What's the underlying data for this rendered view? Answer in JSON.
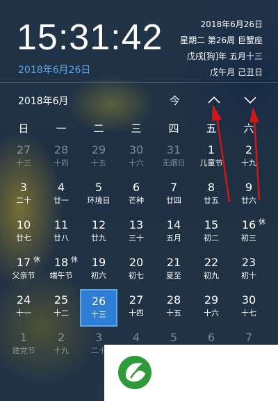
{
  "header": {
    "time": "15:31:42",
    "date_blue": "2018年6月26日",
    "right_lines": [
      "2018年6月26日",
      "星期二 第26周 巨蟹座",
      "戊戌[狗]年 五月十三",
      "戊午月 己丑日"
    ]
  },
  "nav": {
    "month": "2018年6月",
    "today": "今",
    "up_icon": "chevron-up-icon",
    "down_icon": "chevron-down-icon"
  },
  "weekdays": [
    "日",
    "一",
    "二",
    "三",
    "四",
    "五",
    "六"
  ],
  "days": [
    {
      "num": "27",
      "lunar": "十三",
      "other": true
    },
    {
      "num": "28",
      "lunar": "十四",
      "other": true
    },
    {
      "num": "29",
      "lunar": "十五",
      "other": true
    },
    {
      "num": "30",
      "lunar": "十六",
      "other": true
    },
    {
      "num": "31",
      "lunar": "无烟日",
      "other": true
    },
    {
      "num": "1",
      "lunar": "儿童节"
    },
    {
      "num": "2",
      "lunar": "十九"
    },
    {
      "num": "3",
      "lunar": "二十"
    },
    {
      "num": "4",
      "lunar": "廿一"
    },
    {
      "num": "5",
      "lunar": "环境日"
    },
    {
      "num": "6",
      "lunar": "芒种"
    },
    {
      "num": "7",
      "lunar": "廿四"
    },
    {
      "num": "8",
      "lunar": "廿五"
    },
    {
      "num": "9",
      "lunar": "廿六"
    },
    {
      "num": "10",
      "lunar": "廿七"
    },
    {
      "num": "11",
      "lunar": "廿八"
    },
    {
      "num": "12",
      "lunar": "廿九"
    },
    {
      "num": "13",
      "lunar": "三十"
    },
    {
      "num": "14",
      "lunar": "五月"
    },
    {
      "num": "15",
      "lunar": "初二"
    },
    {
      "num": "16",
      "lunar": "初三",
      "tag": "休"
    },
    {
      "num": "17",
      "lunar": "父亲节",
      "tag": "休"
    },
    {
      "num": "18",
      "lunar": "端午节",
      "tag": "休"
    },
    {
      "num": "19",
      "lunar": "初六"
    },
    {
      "num": "20",
      "lunar": "初七"
    },
    {
      "num": "21",
      "lunar": "夏至"
    },
    {
      "num": "22",
      "lunar": "初九"
    },
    {
      "num": "23",
      "lunar": "初十"
    },
    {
      "num": "24",
      "lunar": "十一"
    },
    {
      "num": "25",
      "lunar": "十二"
    },
    {
      "num": "26",
      "lunar": "十三",
      "today": true
    },
    {
      "num": "27",
      "lunar": "十四"
    },
    {
      "num": "28",
      "lunar": "十五"
    },
    {
      "num": "29",
      "lunar": "十六"
    },
    {
      "num": "30",
      "lunar": "十七"
    },
    {
      "num": "1",
      "lunar": "建党节",
      "other": true
    },
    {
      "num": "2",
      "lunar": "十九",
      "other": true
    },
    {
      "num": "3",
      "lunar": "二十",
      "other": true
    },
    {
      "num": "4",
      "lunar": "",
      "other": true
    },
    {
      "num": "5",
      "lunar": "",
      "other": true
    },
    {
      "num": "6",
      "lunar": "",
      "other": true
    },
    {
      "num": "7",
      "lunar": "",
      "other": true
    }
  ],
  "colors": {
    "accent": "#2d7ed4",
    "accent_light": "#5fa6e6",
    "annotation": "#d01818",
    "logo_green": "#2f9a3a"
  },
  "overlay": {
    "logo_icon": "green-leaf-logo-icon"
  }
}
